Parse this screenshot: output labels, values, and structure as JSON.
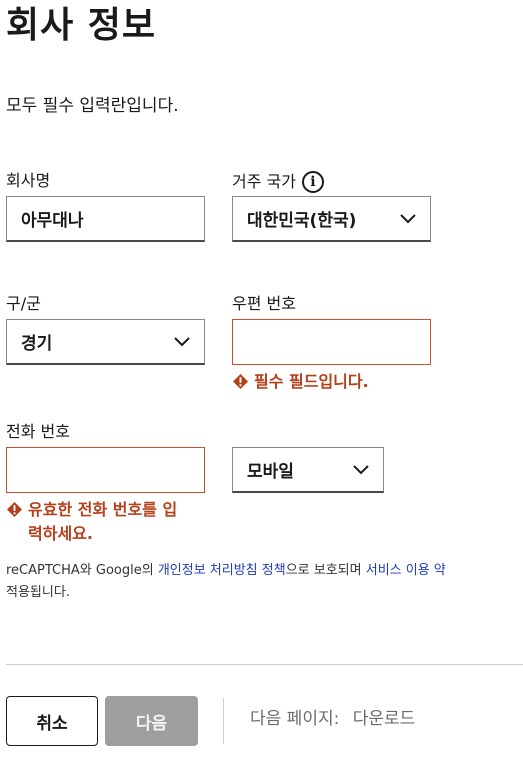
{
  "page": {
    "title": "회사 정보",
    "subtitle": "모두 필수 입력란입니다."
  },
  "form": {
    "company_name": {
      "label": "회사명",
      "value": "아무대나"
    },
    "country": {
      "label": "거주 국가",
      "value": "대한민국(한국)",
      "info_icon": "info-icon"
    },
    "district": {
      "label": "구/군",
      "value": "경기"
    },
    "postal_code": {
      "label": "우편 번호",
      "value": "",
      "error": "필수 필드입니다."
    },
    "phone": {
      "label": "전화 번호",
      "value": "",
      "error_line1": "유효한 전화 번호를 입",
      "error_line2": "력하세요."
    },
    "phone_type": {
      "value": "모바일"
    }
  },
  "legal": {
    "part1": "reCAPTCHA와 Google의 ",
    "privacy_link": "개인정보 처리방침 정책",
    "part2": "으로 보호되며 ",
    "terms_link": "서비스 이용 약",
    "line2": "적용됩니다."
  },
  "footer": {
    "cancel_label": "취소",
    "next_label": "다음",
    "next_page_label": "다음 페이지:",
    "next_page_value": "다운로드"
  },
  "colors": {
    "error": "#b5401c",
    "link": "#1f3dbf",
    "disabled_button": "#9e9e9e"
  }
}
